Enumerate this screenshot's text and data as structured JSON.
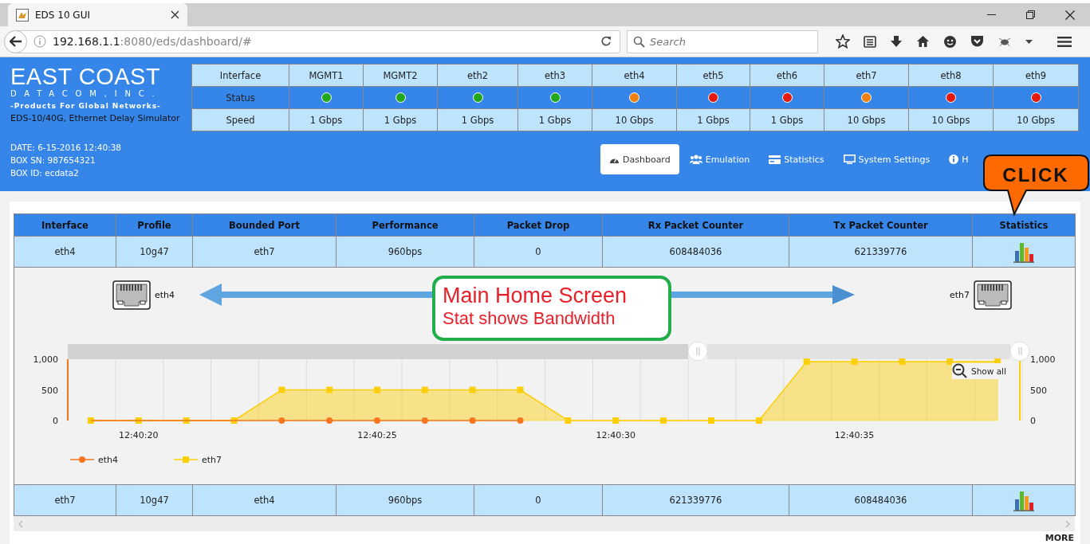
{
  "browser": {
    "tab_title": "EDS 10 GUI",
    "url_host": "192.168.1.1",
    "url_path": ":8080/eds/dashboard/#",
    "search_placeholder": "Search"
  },
  "header": {
    "logo_title": "EAST COAST",
    "logo_subtitle": "DATACOM,INC.",
    "tagline": "-Products For Global Networks-",
    "product": "EDS-10/40G, Ethernet Delay Simulator",
    "info": [
      "DATE: 6-15-2016 12:40:38",
      "BOX SN: 987654321",
      "BOX ID: ecdata2"
    ]
  },
  "port_table": {
    "row_labels": [
      "Interface",
      "Status",
      "Speed"
    ],
    "ports": [
      {
        "name": "MGMT1",
        "color": "#22a81e",
        "speed": "1 Gbps"
      },
      {
        "name": "MGMT2",
        "color": "#22a81e",
        "speed": "1 Gbps"
      },
      {
        "name": "eth2",
        "color": "#22a81e",
        "speed": "1 Gbps"
      },
      {
        "name": "eth3",
        "color": "#22a81e",
        "speed": "1 Gbps"
      },
      {
        "name": "eth4",
        "color": "#f08010",
        "speed": "10 Gbps"
      },
      {
        "name": "eth5",
        "color": "#e41a0e",
        "speed": "1 Gbps"
      },
      {
        "name": "eth6",
        "color": "#e41a0e",
        "speed": "1 Gbps"
      },
      {
        "name": "eth7",
        "color": "#f08010",
        "speed": "10 Gbps"
      },
      {
        "name": "eth8",
        "color": "#e41a0e",
        "speed": "10 Gbps"
      },
      {
        "name": "eth9",
        "color": "#e41a0e",
        "speed": "10 Gbps"
      }
    ]
  },
  "nav": [
    {
      "label": "Dashboard",
      "selected": true
    },
    {
      "label": "Emulation",
      "selected": false
    },
    {
      "label": "Statistics",
      "selected": false
    },
    {
      "label": "System Settings",
      "selected": false
    },
    {
      "label": "H",
      "selected": false
    }
  ],
  "table": {
    "columns": [
      "Interface",
      "Profile",
      "Bounded Port",
      "Performance",
      "Packet Drop",
      "Rx Packet Counter",
      "Tx Packet Counter",
      "Statistics"
    ],
    "rows": [
      {
        "cells": [
          "eth4",
          "10g47",
          "eth7",
          "960bps",
          "0",
          "608484036",
          "621339776"
        ],
        "expanded": true,
        "panel": {
          "left_port": "eth4",
          "right_port": "eth7",
          "show_all": "Show all",
          "chart_data": {
            "type": "area",
            "categories": [
              null,
              "12:40:20",
              null,
              null,
              null,
              null,
              "12:40:25",
              null,
              null,
              null,
              null,
              "12:40:30",
              null,
              null,
              null,
              null,
              "12:40:35",
              null,
              null,
              null
            ],
            "series": [
              {
                "name": "eth4",
                "type": "line",
                "color": "#f7751f",
                "values": [
                  0,
                  0,
                  0,
                  0,
                  0,
                  0,
                  0,
                  0,
                  0,
                  0,
                  null,
                  null,
                  null,
                  null,
                  null,
                  null,
                  null,
                  null,
                  null,
                  null
                ]
              },
              {
                "name": "eth7",
                "color": "#fccf0a",
                "values": [
                  0,
                  0,
                  0,
                  0,
                  500,
                  500,
                  500,
                  500,
                  500,
                  500,
                  0,
                  0,
                  0,
                  0,
                  0,
                  960,
                  960,
                  960,
                  960,
                  960
                ]
              }
            ],
            "legend": true,
            "ylim": [
              0,
              1000
            ],
            "yticks": [
              0,
              500,
              {
                "value": 1000,
                "label": "1,000"
              }
            ],
            "y2lim": [
              0,
              1000
            ],
            "y2ticks": [
              0,
              500,
              {
                "value": 1000,
                "label": "1,000"
              }
            ]
          }
        }
      },
      {
        "cells": [
          "eth7",
          "10g47",
          "eth4",
          "960bps",
          "0",
          "621339776",
          "608484036"
        ],
        "expanded": false
      }
    ]
  },
  "more": "MORE",
  "annotations": [
    {
      "kind": "note",
      "lines": [
        "Main Home Screen",
        "Stat shows Bandwidth"
      ]
    },
    {
      "kind": "callout",
      "text": "CLICK"
    }
  ]
}
